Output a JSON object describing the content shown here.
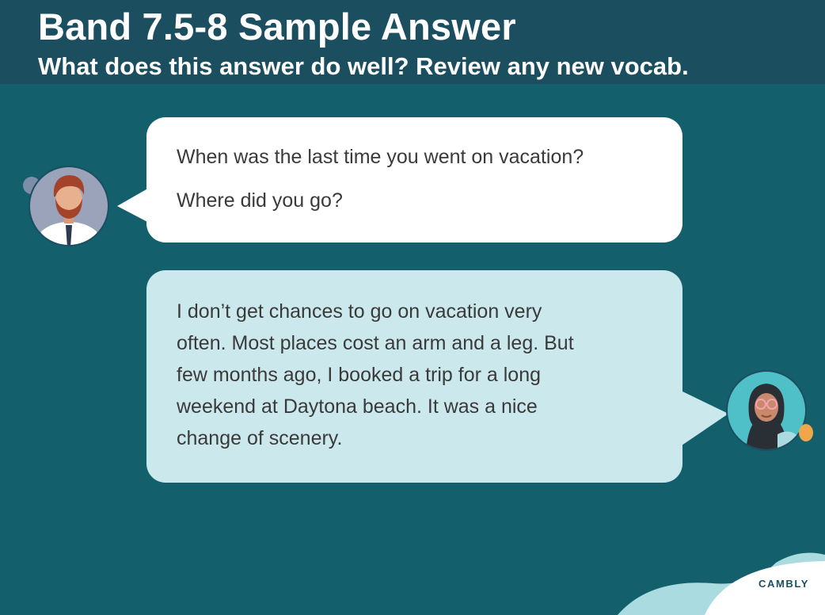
{
  "header": {
    "title": "Band 7.5-8 Sample Answer",
    "subtitle": "What does this answer do well? Review any new vocab."
  },
  "question": {
    "line1": "When was the last time you went on vacation?",
    "line2": "Where did you go?"
  },
  "answer": {
    "text": "I don’t get chances to go on vacation very\noften. Most places cost an arm and a leg. But\nfew months ago, I booked a trip for a long\nweekend at Daytona beach. It was a nice\nchange of scenery."
  },
  "brand": {
    "logo_text": "CAMBLY"
  },
  "colors": {
    "background": "#135f6c",
    "header": "#1b4f60",
    "question_bubble": "#ffffff",
    "answer_bubble": "#cbe9ec",
    "accent_wave": "#a9dbe0"
  },
  "icons": {
    "examiner": "man-avatar-icon",
    "candidate": "woman-avatar-icon"
  }
}
